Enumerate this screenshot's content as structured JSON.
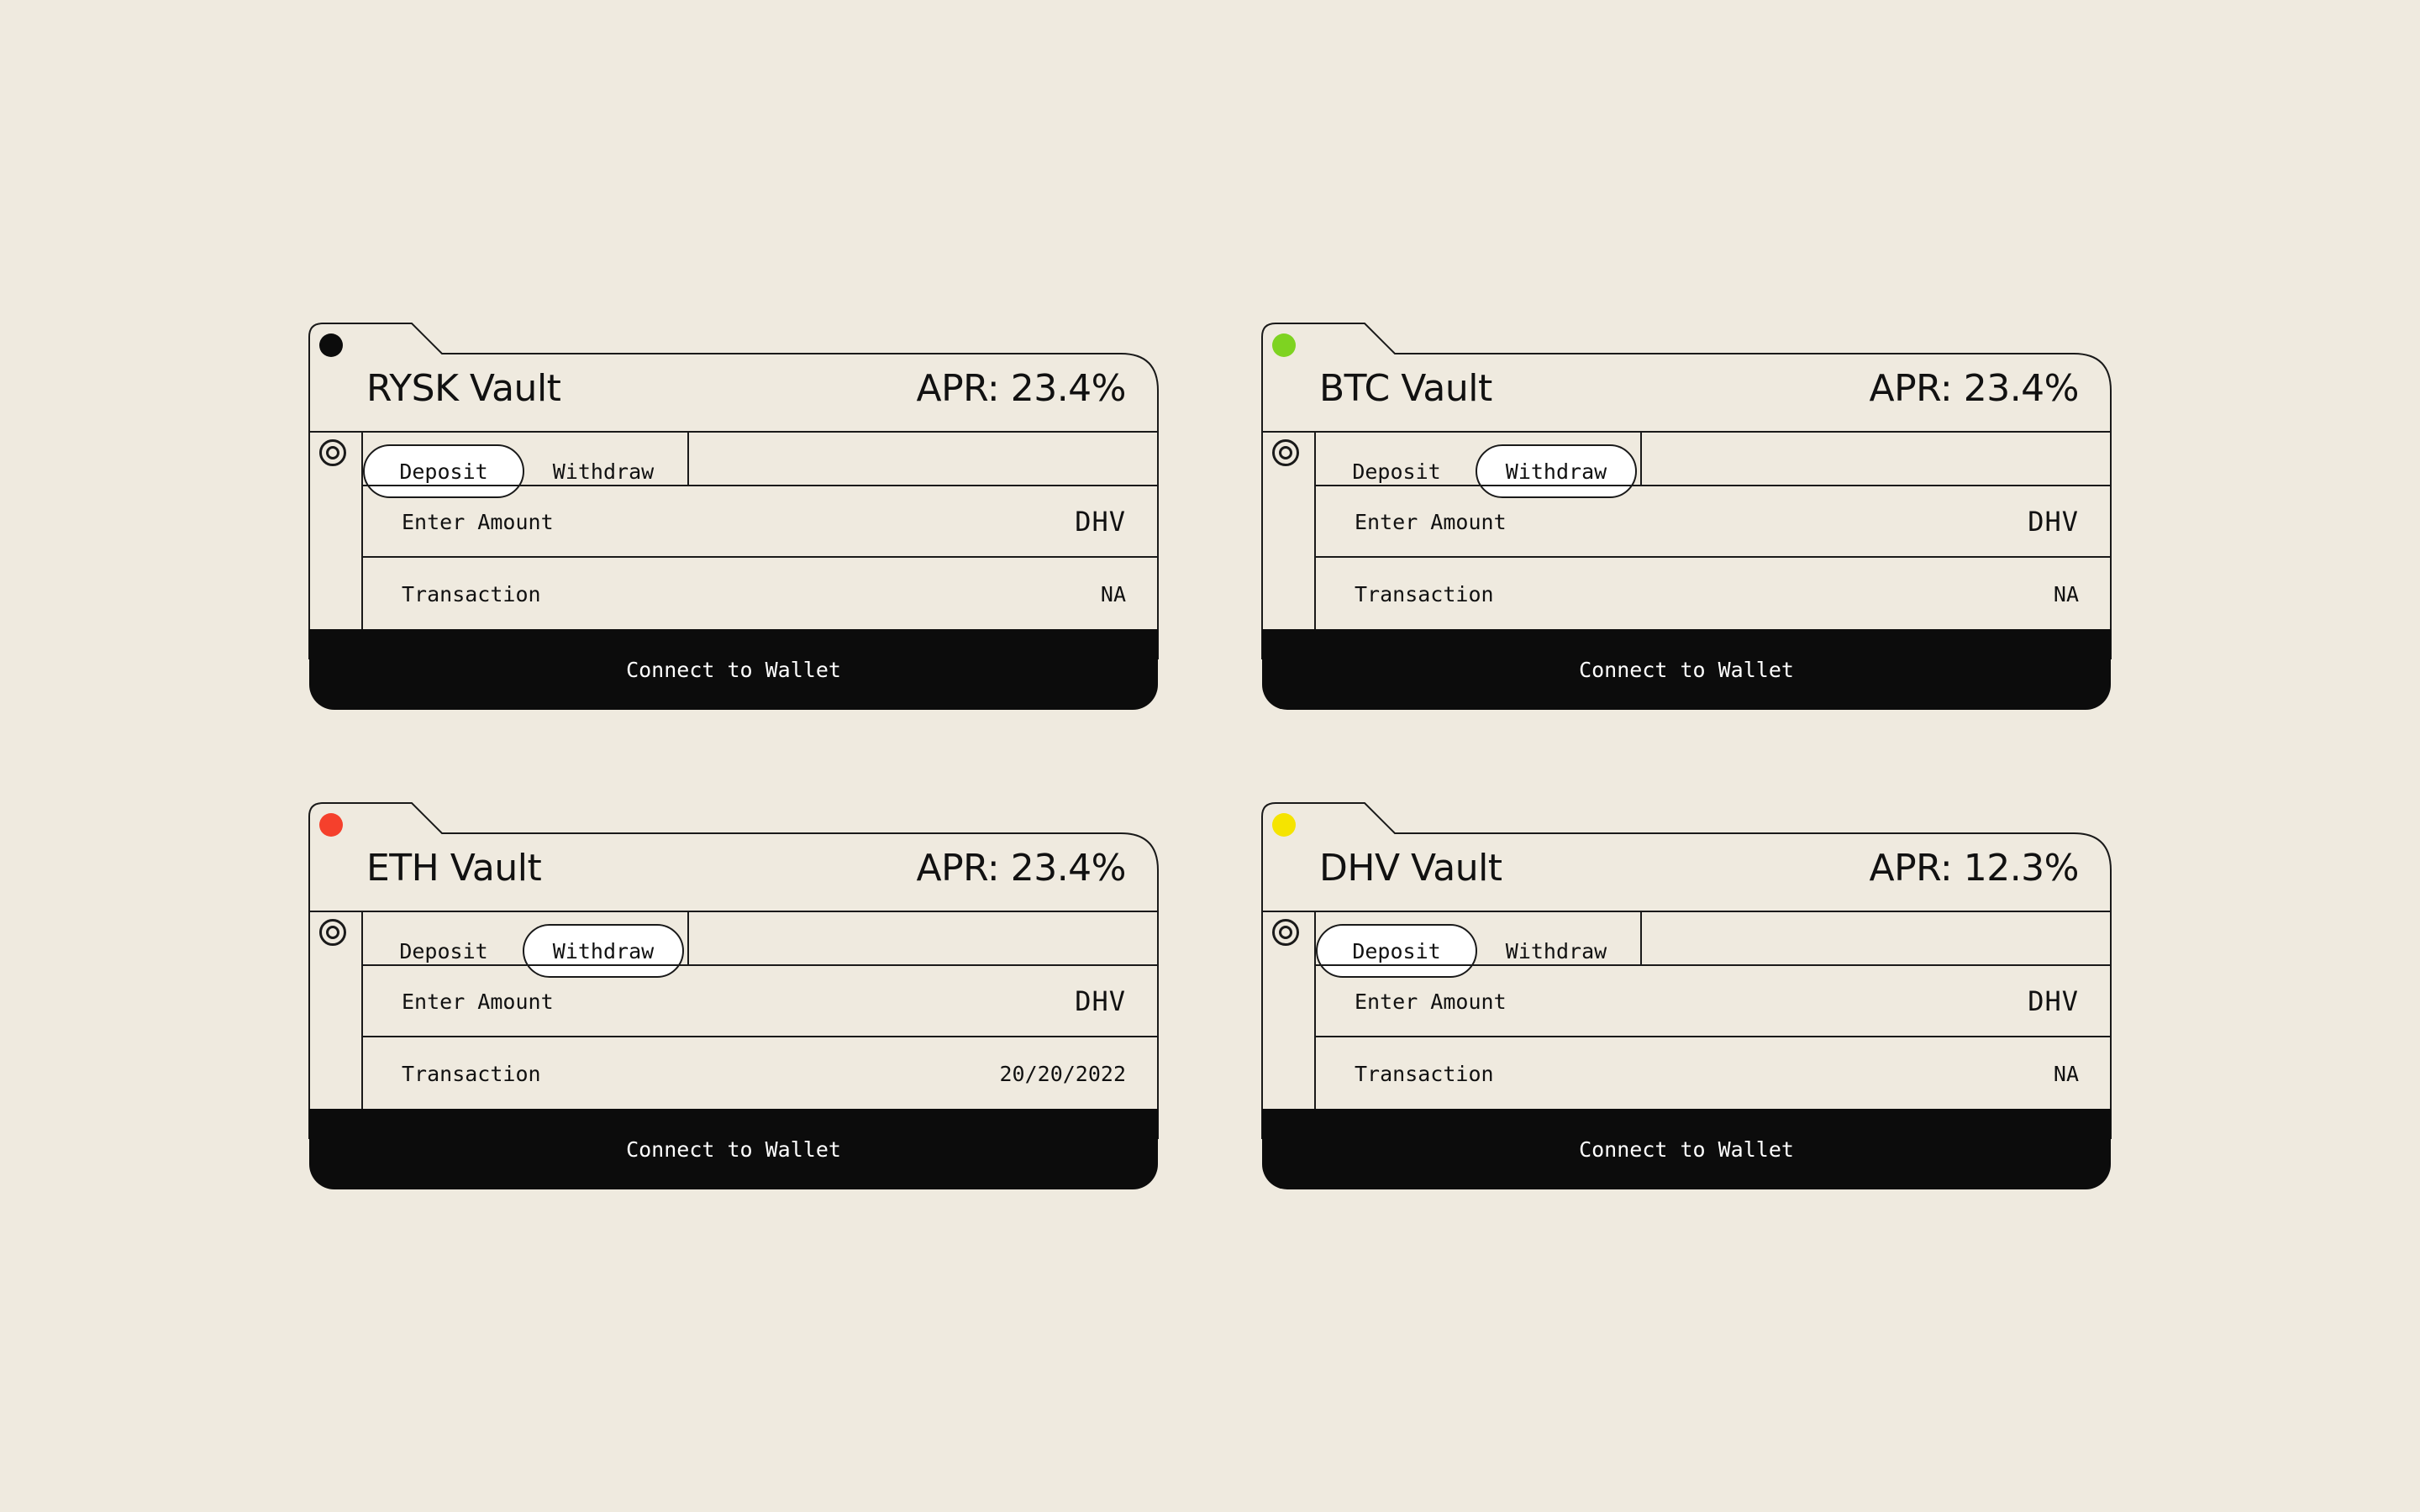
{
  "vaults": [
    {
      "title": "RYSK Vault",
      "apr": "APR: 23.4%",
      "status_color": "#0c0c0c",
      "tabs": {
        "deposit": "Deposit",
        "withdraw": "Withdraw",
        "active": "deposit"
      },
      "amount_label": "Enter Amount",
      "amount_token": "DHV",
      "transaction_label": "Transaction",
      "transaction_value": "NA",
      "connect_label": "Connect to Wallet",
      "side_icon": "circle-target-icon"
    },
    {
      "title": "BTC Vault",
      "apr": "APR: 23.4%",
      "status_color": "#7ed321",
      "tabs": {
        "deposit": "Deposit",
        "withdraw": "Withdraw",
        "active": "withdraw"
      },
      "amount_label": "Enter Amount",
      "amount_token": "DHV",
      "transaction_label": "Transaction",
      "transaction_value": "NA",
      "connect_label": "Connect to Wallet",
      "side_icon": "circle-target-icon"
    },
    {
      "title": "ETH Vault",
      "apr": "APR: 23.4%",
      "status_color": "#f5402c",
      "tabs": {
        "deposit": "Deposit",
        "withdraw": "Withdraw",
        "active": "withdraw"
      },
      "amount_label": "Enter Amount",
      "amount_token": "DHV",
      "transaction_label": "Transaction",
      "transaction_value": "20/20/2022",
      "connect_label": "Connect to Wallet",
      "side_icon": "circle-target-icon"
    },
    {
      "title": "DHV Vault",
      "apr": "APR: 12.3%",
      "status_color": "#f5e400",
      "tabs": {
        "deposit": "Deposit",
        "withdraw": "Withdraw",
        "active": "deposit"
      },
      "amount_label": "Enter Amount",
      "amount_token": "DHV",
      "transaction_label": "Transaction",
      "transaction_value": "NA",
      "connect_label": "Connect to Wallet",
      "side_icon": "circle-target-icon"
    }
  ]
}
